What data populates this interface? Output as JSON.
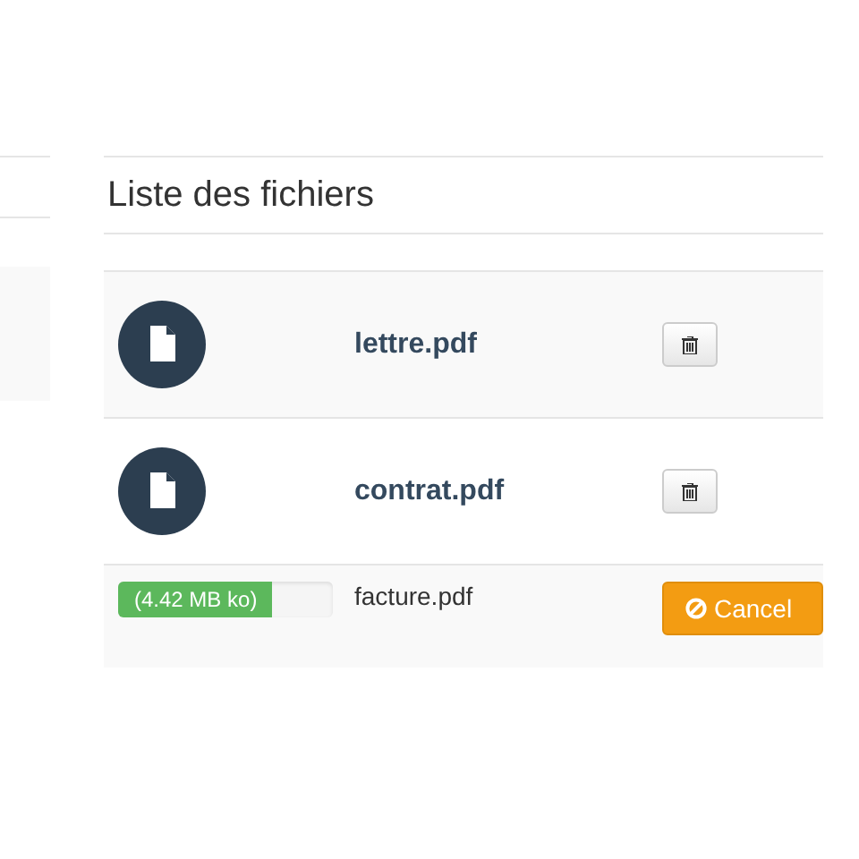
{
  "title": "Liste des fichiers",
  "files": [
    {
      "kind": "done",
      "name": "lettre.pdf"
    },
    {
      "kind": "done",
      "name": "contrat.pdf"
    },
    {
      "kind": "uploading",
      "name": "facture.pdf",
      "progress_label": "(4.42 MB ko)",
      "level": 0.72,
      "action": "Cancel"
    }
  ]
}
